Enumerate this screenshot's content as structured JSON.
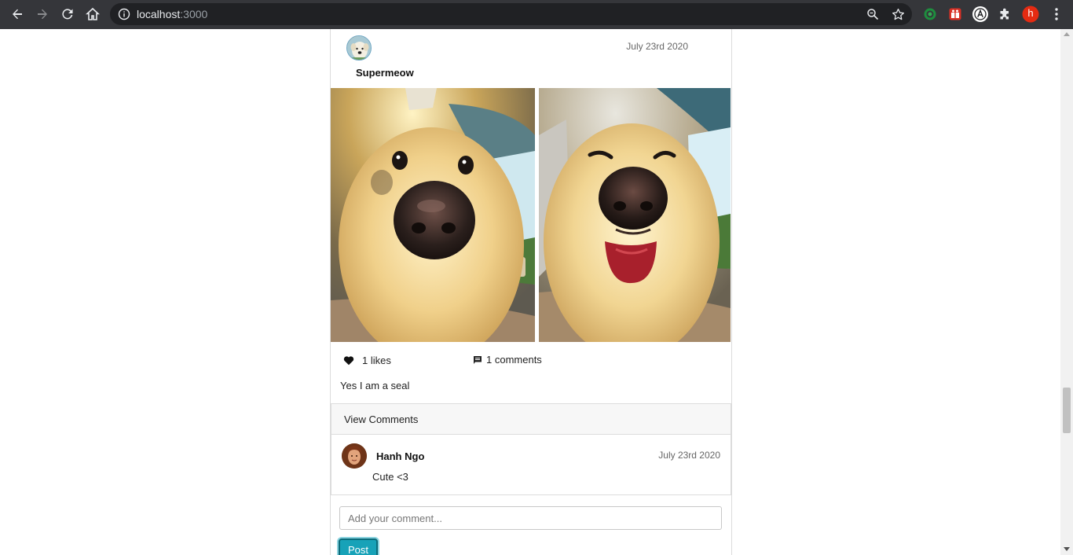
{
  "browser": {
    "url_host": "localhost",
    "url_port": ":3000",
    "profile_initial": "h"
  },
  "post": {
    "username": "Supermeow",
    "date": "July 23rd 2020",
    "likes_text": "1 likes",
    "comments_text": "1 comments",
    "caption": "Yes I am a seal",
    "view_comments_label": "View Comments"
  },
  "comments": [
    {
      "author": "Hanh Ngo",
      "date": "July 23rd 2020",
      "text": "Cute <3"
    }
  ],
  "comment_form": {
    "placeholder": "Add your comment...",
    "submit_label": "Post"
  },
  "colors": {
    "accent": "#17a2b8",
    "chrome_bg": "#35363a",
    "omnibox_bg": "#202124"
  }
}
